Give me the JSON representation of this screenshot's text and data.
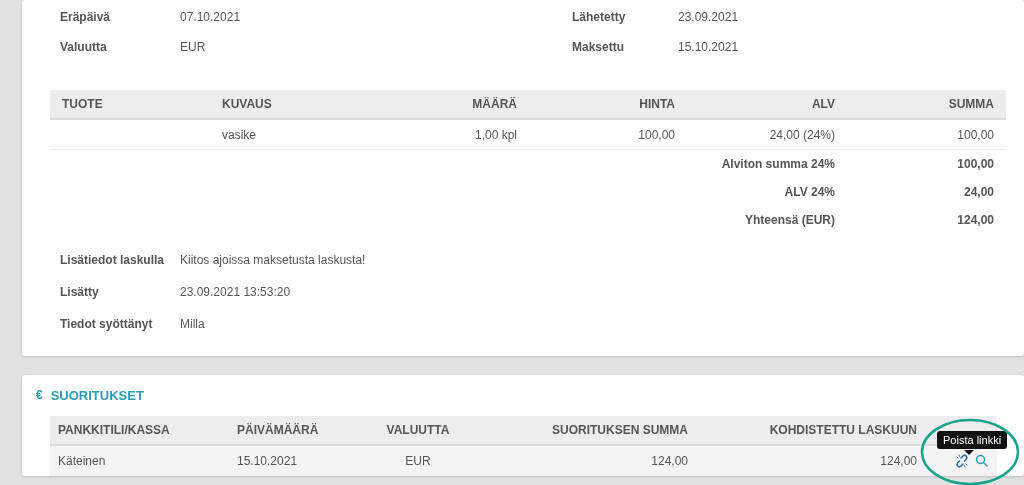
{
  "invoice_details": {
    "left": [
      {
        "label": "Eräpäivä",
        "value": "07.10.2021"
      },
      {
        "label": "Valuutta",
        "value": "EUR"
      }
    ],
    "right": [
      {
        "label": "Lähetetty",
        "value": "23.09.2021"
      },
      {
        "label": "Maksettu",
        "value": "15.10.2021"
      }
    ]
  },
  "items_table": {
    "columns": [
      "TUOTE",
      "KUVAUS",
      "MÄÄRÄ",
      "HINTA",
      "ALV",
      "SUMMA"
    ],
    "rows": [
      {
        "cells": [
          "",
          "vasike",
          "1,00 kpl",
          "100,00",
          "24,00 (24%)",
          "100,00"
        ]
      }
    ],
    "totals": [
      {
        "label": "Alviton summa 24%",
        "value": "100,00"
      },
      {
        "label": "ALV 24%",
        "value": "24,00"
      },
      {
        "label": "Yhteensä (EUR)",
        "value": "124,00"
      }
    ]
  },
  "extra_info": [
    {
      "label": "Lisätiedot laskulla",
      "value": "Kiitos ajoissa maksetusta laskusta!"
    },
    {
      "label": "Lisätty",
      "value": "23.09.2021 13:53:20"
    },
    {
      "label": "Tiedot syöttänyt",
      "value": "Milla"
    }
  ],
  "payments": {
    "icon": "€",
    "title": "SUORITUKSET",
    "columns": [
      "PANKKITILI/KASSA",
      "PÄIVÄMÄÄRÄ",
      "VALUUTTA",
      "SUORITUKSEN SUMMA",
      "KOHDISTETTU LASKUUN"
    ],
    "rows": [
      {
        "cells": [
          "Käteinen",
          "15.10.2021",
          "EUR",
          "124,00",
          "124,00"
        ]
      }
    ],
    "tooltip": "Poista linkki"
  }
}
